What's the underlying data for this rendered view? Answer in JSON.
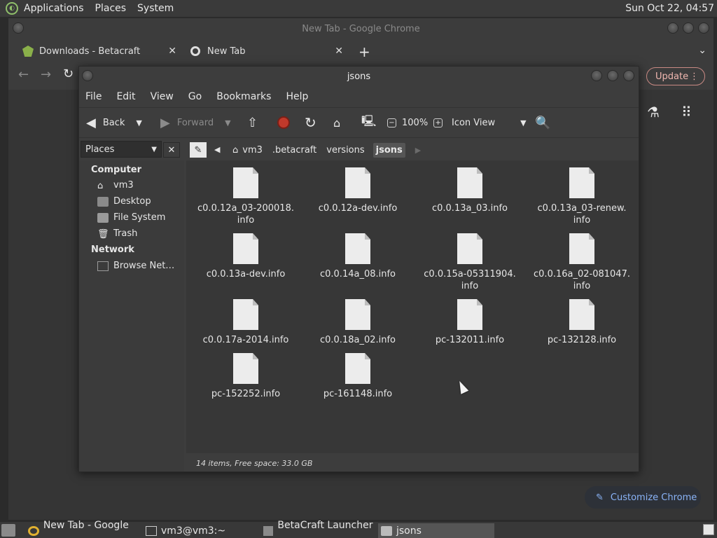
{
  "top_panel": {
    "menus": [
      "Applications",
      "Places",
      "System"
    ],
    "clock": "Sun Oct 22, 04:57"
  },
  "chrome": {
    "title": "New Tab - Google Chrome",
    "tabs": [
      {
        "label": "Downloads - Betacraft"
      },
      {
        "label": "New Tab"
      }
    ],
    "update_label": "Update",
    "customize_label": "Customize Chrome"
  },
  "file_manager": {
    "title": "jsons",
    "menu": [
      "File",
      "Edit",
      "View",
      "Go",
      "Bookmarks",
      "Help"
    ],
    "toolbar": {
      "back": "Back",
      "forward": "Forward",
      "zoom": "100%",
      "view_mode": "Icon View"
    },
    "sidebar": {
      "combo": "Places",
      "sections": [
        {
          "heading": "Computer",
          "items": [
            "vm3",
            "Desktop",
            "File System",
            "Trash"
          ]
        },
        {
          "heading": "Network",
          "items": [
            "Browse Net…"
          ]
        }
      ]
    },
    "path": [
      "vm3",
      ".betacraft",
      "versions",
      "jsons"
    ],
    "files": [
      "c0.0.12a_03-200018.\ninfo",
      "c0.0.12a-dev.info",
      "c0.0.13a_03.info",
      "c0.0.13a_03-renew.\ninfo",
      "c0.0.13a-dev.info",
      "c0.0.14a_08.info",
      "c0.0.15a-05311904.\ninfo",
      "c0.0.16a_02-081047.\ninfo",
      "c0.0.17a-2014.info",
      "c0.0.18a_02.info",
      "pc-132011.info",
      "pc-132128.info",
      "pc-152252.info",
      "pc-161148.info"
    ],
    "status": "14 items, Free space: 33.0 GB"
  },
  "taskbar": {
    "tasks": [
      "New Tab - Google ...",
      "vm3@vm3:~",
      "BetaCraft Launcher ...",
      "jsons"
    ]
  }
}
